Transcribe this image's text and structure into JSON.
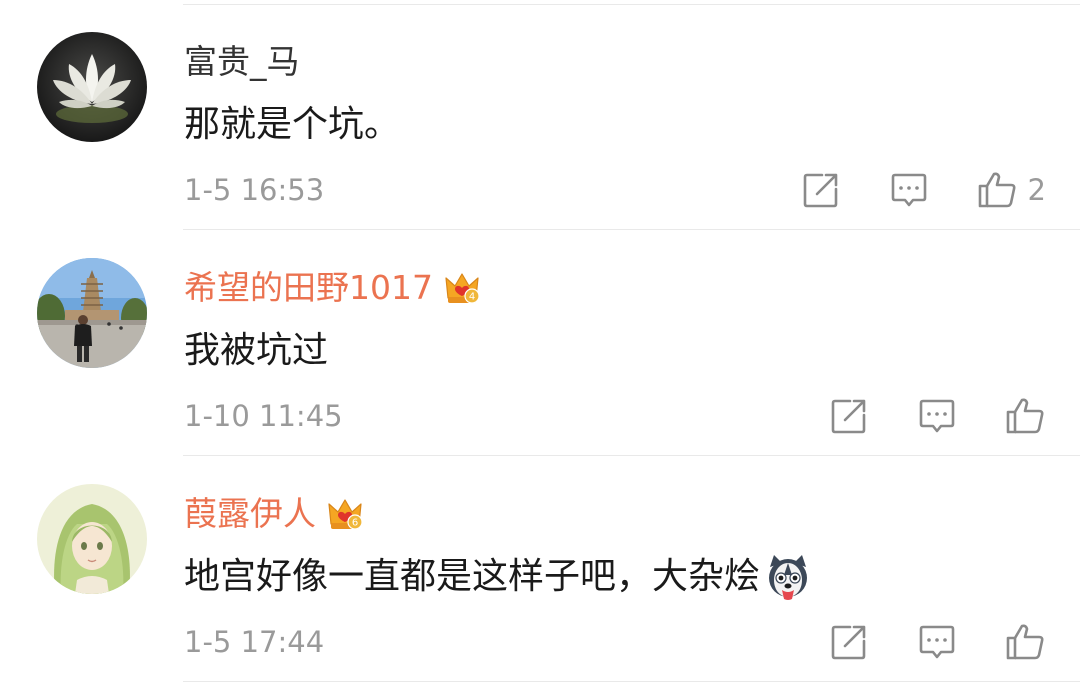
{
  "comments": [
    {
      "username": "富贵_马",
      "vip": false,
      "text": "那就是个坑。",
      "time": "1-5 16:53",
      "likes": "2",
      "avatar": "lotus-avatar",
      "icons": [
        "share-icon",
        "comment-icon",
        "like-icon"
      ]
    },
    {
      "username": "希望的田野1017",
      "vip": true,
      "vip_level": "4",
      "text": "我被坑过",
      "time": "1-10 11:45",
      "likes": "",
      "avatar": "pagoda-photo-avatar",
      "icons": [
        "share-icon",
        "comment-icon",
        "like-icon"
      ]
    },
    {
      "username": "葭露伊人",
      "vip": true,
      "vip_level": "6",
      "text": "地宫好像一直都是这样子吧，大杂烩",
      "time": "1-5 17:44",
      "likes": "",
      "avatar": "anime-girl-avatar",
      "emoji": "husky-emoji",
      "icons": [
        "share-icon",
        "comment-icon",
        "like-icon"
      ]
    }
  ],
  "colors": {
    "username": "#333333",
    "vip_username": "#eb7350",
    "text": "#1a1a1a",
    "meta": "#9a9a9a",
    "divider": "#e9e9e9",
    "vip_badge": "#f5a623"
  }
}
